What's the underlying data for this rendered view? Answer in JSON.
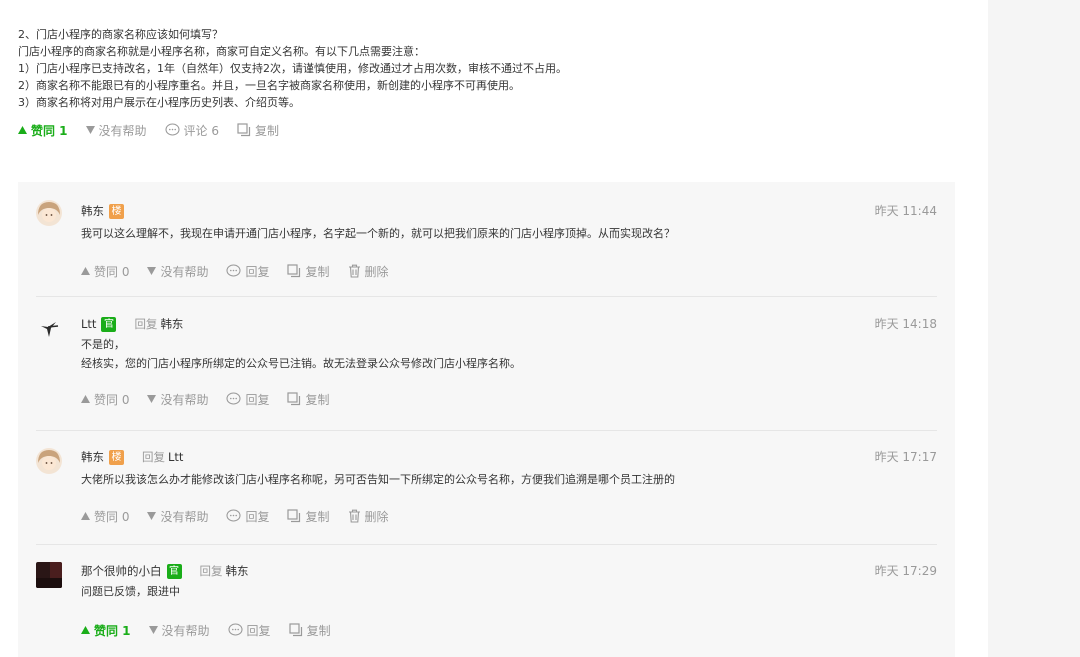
{
  "answer": {
    "lines": [
      "2、门店小程序的商家名称应该如何填写？",
      "门店小程序的商家名称就是小程序名称，商家可自定义名称。有以下几点需要注意：",
      "1）门店小程序已支持改名，1年（自然年）仅支持2次，请谨慎使用，修改通过才占用次数，审核不通过不占用。",
      "2）商家名称不能跟已有的小程序重名。并且，一旦名字被商家名称使用，新创建的小程序不可再使用。",
      "3）商家名称将对用户展示在小程序历史列表、介绍页等。"
    ],
    "ops": {
      "like": "赞同 1",
      "unhelpful": "没有帮助",
      "comment": "评论 6",
      "copy": "复制"
    }
  },
  "comments": [
    {
      "name": "韩东",
      "badge": "楼",
      "reply_label": "",
      "reply_to": "",
      "time": "昨天 11:44",
      "text": [
        "我可以这么理解不，我现在申请开通门店小程序，名字起一个新的，就可以把我们原来的门店小程序顶掉。从而实现改名？"
      ],
      "like": "赞同 0",
      "unhelpful": "没有帮助",
      "reply": "回复",
      "copy": "复制",
      "delete": "删除"
    },
    {
      "name": "Ltt",
      "badge": "官",
      "reply_label": "回复",
      "reply_to": "韩东",
      "time": "昨天 14:18",
      "text": [
        "不是的，",
        "经核实，您的门店小程序所绑定的公众号已注销。故无法登录公众号修改门店小程序名称。"
      ],
      "like": "赞同 0",
      "unhelpful": "没有帮助",
      "reply": "回复",
      "copy": "复制"
    },
    {
      "name": "韩东",
      "badge": "楼",
      "reply_label": "回复",
      "reply_to": "Ltt",
      "time": "昨天 17:17",
      "text": [
        "大佬所以我该怎么办才能修改该门店小程序名称呢，另可否告知一下所绑定的公众号名称，方便我们追溯是哪个员工注册的"
      ],
      "like": "赞同 0",
      "unhelpful": "没有帮助",
      "reply": "回复",
      "copy": "复制",
      "delete": "删除"
    },
    {
      "name": "那个很帅的小白",
      "badge": "官",
      "reply_label": "回复",
      "reply_to": "韩东",
      "time": "昨天 17:29",
      "text": [
        "问题已反馈，跟进中"
      ],
      "like": "赞同 1",
      "unhelpful": "没有帮助",
      "reply": "回复",
      "copy": "复制"
    }
  ],
  "colors": {
    "accent_green": "#1aad19",
    "louzhu_badge": "#f0a04b",
    "muted_text": "#9a9a9a",
    "comment_bg": "#f7f7f7"
  },
  "icons": [
    "triangle-up-icon",
    "triangle-down-icon",
    "comment-bubble-icon",
    "copy-icon",
    "trash-icon"
  ]
}
